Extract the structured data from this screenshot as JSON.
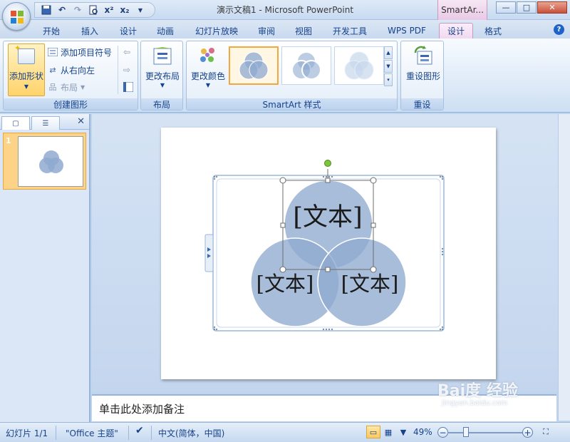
{
  "window": {
    "title": "演示文稿1 - Microsoft PowerPoint",
    "context_tab_title": "SmartAr...",
    "controls": {
      "minimize": "—",
      "maximize": "□",
      "close": "✕"
    }
  },
  "quick_access": [
    "save",
    "undo",
    "redo",
    "print-preview",
    "superscript",
    "subscript",
    "more"
  ],
  "quick_access_labels": {
    "superscript": "x²",
    "subscript": "x₂"
  },
  "tabs": [
    {
      "label": "开始"
    },
    {
      "label": "插入"
    },
    {
      "label": "设计"
    },
    {
      "label": "动画"
    },
    {
      "label": "幻灯片放映"
    },
    {
      "label": "审阅"
    },
    {
      "label": "视图"
    },
    {
      "label": "开发工具"
    },
    {
      "label": "WPS PDF"
    },
    {
      "label": "设计",
      "active": true
    },
    {
      "label": "格式"
    }
  ],
  "help_label": "?",
  "ribbon": {
    "create": {
      "group_label": "创建图形",
      "add_shape": "添加形状",
      "add_bullet": "添加项目符号",
      "right_to_left": "从右向左",
      "layout": "布局"
    },
    "layout": {
      "group_label": "布局",
      "change_layout": "更改布局"
    },
    "styles": {
      "group_label": "SmartArt 样式",
      "change_colors": "更改颜色"
    },
    "reset": {
      "group_label": "重设",
      "reset_graphic": "重设图形"
    }
  },
  "slide_panel": {
    "slide_number": "1"
  },
  "smartart": {
    "top_text": "[文本]",
    "left_text": "[文本]",
    "right_text": "[文本]"
  },
  "notes": {
    "placeholder": "单击此处添加备注"
  },
  "status": {
    "slide_count": "幻灯片 1/1",
    "theme": "\"Office 主题\"",
    "language": "中文(简体，中国)",
    "zoom": "49%"
  },
  "watermark": {
    "main": "Bai度 经验",
    "sub": "jingyan.baidu.com"
  },
  "colors": {
    "accent": "#15428b",
    "circle_fill": "#8faad0",
    "selection": "#f2a83c"
  }
}
